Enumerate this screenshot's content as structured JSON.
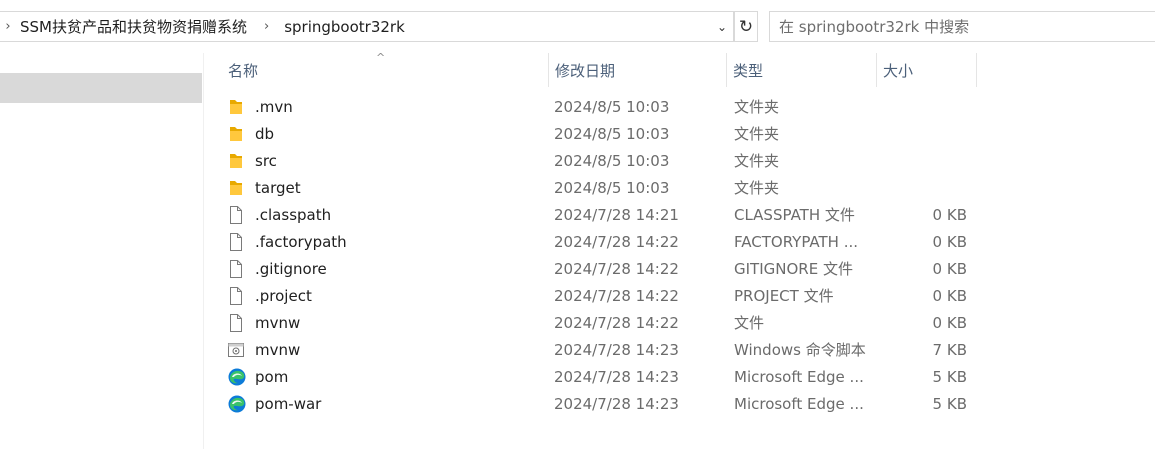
{
  "address": {
    "crumbs": [
      "SSM扶贫产品和扶贫物资捐赠系统",
      "springbootr32rk"
    ],
    "search_placeholder": "在 springbootr32rk 中搜索"
  },
  "columns": {
    "name": "名称",
    "date": "修改日期",
    "type": "类型",
    "size": "大小"
  },
  "files": [
    {
      "name": ".mvn",
      "date": "2024/8/5 10:03",
      "type": "文件夹",
      "size": "",
      "icon": "folder-icon"
    },
    {
      "name": "db",
      "date": "2024/8/5 10:03",
      "type": "文件夹",
      "size": "",
      "icon": "folder-icon"
    },
    {
      "name": "src",
      "date": "2024/8/5 10:03",
      "type": "文件夹",
      "size": "",
      "icon": "folder-icon"
    },
    {
      "name": "target",
      "date": "2024/8/5 10:03",
      "type": "文件夹",
      "size": "",
      "icon": "folder-icon"
    },
    {
      "name": ".classpath",
      "date": "2024/7/28 14:21",
      "type": "CLASSPATH 文件",
      "size": "0 KB",
      "icon": "file-icon"
    },
    {
      "name": ".factorypath",
      "date": "2024/7/28 14:22",
      "type": "FACTORYPATH ...",
      "size": "0 KB",
      "icon": "file-icon"
    },
    {
      "name": ".gitignore",
      "date": "2024/7/28 14:22",
      "type": "GITIGNORE 文件",
      "size": "0 KB",
      "icon": "file-icon"
    },
    {
      "name": ".project",
      "date": "2024/7/28 14:22",
      "type": "PROJECT 文件",
      "size": "0 KB",
      "icon": "file-icon"
    },
    {
      "name": "mvnw",
      "date": "2024/7/28 14:22",
      "type": "文件",
      "size": "0 KB",
      "icon": "file-icon"
    },
    {
      "name": "mvnw",
      "date": "2024/7/28 14:23",
      "type": "Windows 命令脚本",
      "size": "7 KB",
      "icon": "script-icon"
    },
    {
      "name": "pom",
      "date": "2024/7/28 14:23",
      "type": "Microsoft Edge ...",
      "size": "5 KB",
      "icon": "edge-icon"
    },
    {
      "name": "pom-war",
      "date": "2024/7/28 14:23",
      "type": "Microsoft Edge ...",
      "size": "5 KB",
      "icon": "edge-icon"
    }
  ]
}
